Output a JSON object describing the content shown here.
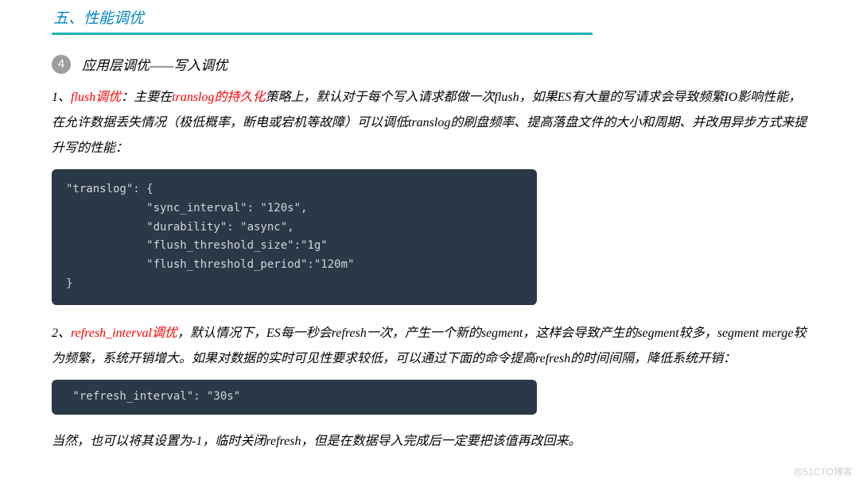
{
  "header": {
    "title": "五、性能调优"
  },
  "section": {
    "number": "4",
    "title": "应用层调优——写入调优"
  },
  "p1": {
    "prefix": "1、",
    "r1": "flush调优",
    "t1": "：主要在",
    "r2": "translog的持久化",
    "t2": "策略上，默认对于每个写入请求都做一次flush，如果ES有大量的写请求会导致频繁IO影响性能，在允许数据丢失情况（极低概率，断电或宕机等故障）可以调低translog的刷盘频率、提高落盘文件的大小和周期、并改用异步方式来提升写的性能："
  },
  "code1": "\"translog\": {\n            \"sync_interval\": \"120s\",\n            \"durability\": \"async\",\n            \"flush_threshold_size\":\"1g\"\n            \"flush_threshold_period\":\"120m\"\n}",
  "p2": {
    "prefix": "2、",
    "r1": "refresh_interval调优",
    "t1": "，默认情况下，ES每一秒会refresh一次，产生一个新的segment，这样会导致产生的segment较多，segment merge较为频繁，系统开销增大。如果对数据的实时可见性要求较低，可以通过下面的命令提高refresh的时间间隔，降低系统开销："
  },
  "code2": " \"refresh_interval\": \"30s\"",
  "p3": "当然，也可以将其设置为-1，临时关闭refresh，但是在数据导入完成后一定要把该值再改回来。",
  "watermark": "@51CTO博客"
}
